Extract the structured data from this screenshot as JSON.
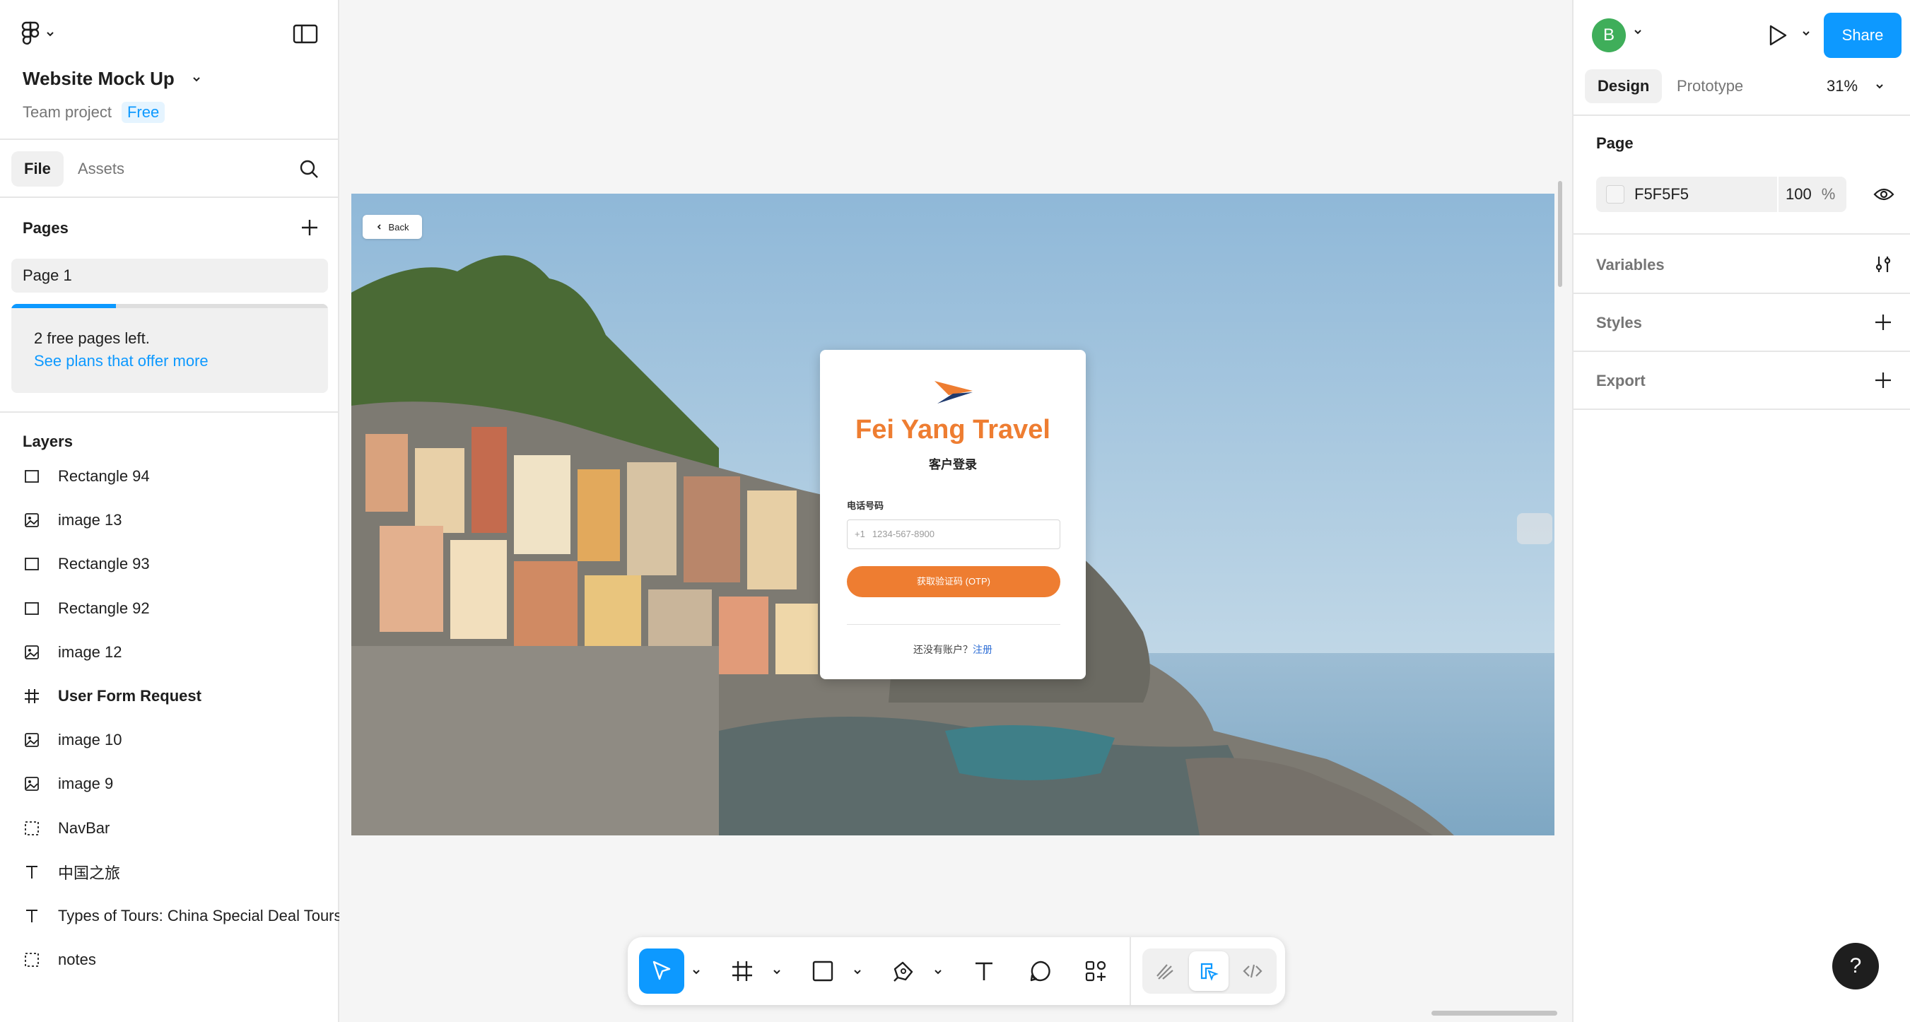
{
  "left_panel": {
    "file_name": "Website Mock Up",
    "project_label": "Team project",
    "plan_badge": "Free",
    "tabs": {
      "file": "File",
      "assets": "Assets"
    },
    "pages_title": "Pages",
    "pages": [
      "Page 1"
    ],
    "quota": {
      "text": "2 free pages left.",
      "link": "See plans that offer more",
      "used_fraction": 0.33
    },
    "layers_title": "Layers",
    "layers": [
      {
        "name": "Rectangle 94",
        "icon": "rectangle-icon"
      },
      {
        "name": "image 13",
        "icon": "image-icon"
      },
      {
        "name": "Rectangle 93",
        "icon": "rectangle-icon"
      },
      {
        "name": "Rectangle 92",
        "icon": "rectangle-icon"
      },
      {
        "name": "image 12",
        "icon": "image-icon"
      },
      {
        "name": "User Form Request",
        "icon": "frame-icon"
      },
      {
        "name": "image 10",
        "icon": "image-icon"
      },
      {
        "name": "image 9",
        "icon": "image-icon"
      },
      {
        "name": "NavBar",
        "icon": "component-frame-icon"
      },
      {
        "name": "中国之旅",
        "icon": "text-icon"
      },
      {
        "name": "Types of Tours: China Special Deal Tours",
        "icon": "text-icon"
      },
      {
        "name": "notes",
        "icon": "component-frame-icon"
      }
    ]
  },
  "canvas": {
    "back_label": "Back",
    "brand_name": "Fei Yang Travel",
    "login_title": "客户登录",
    "phone_label": "电话号码",
    "phone_prefix": "+1",
    "phone_placeholder": "1234-567-8900",
    "otp_button": "获取验证码 (OTP)",
    "signup_prompt": "还没有账户？",
    "signup_link": "注册"
  },
  "right_panel": {
    "avatar_initial": "B",
    "share_label": "Share",
    "tabs": {
      "design": "Design",
      "prototype": "Prototype"
    },
    "zoom": "31%",
    "page_section": "Page",
    "page_color": "F5F5F5",
    "page_opacity": "100",
    "opacity_unit": "%",
    "variables_section": "Variables",
    "styles_section": "Styles",
    "export_section": "Export",
    "help_label": "?"
  },
  "colors": {
    "accent": "#0d99ff",
    "brand_orange": "#ee7d31",
    "avatar": "#3fae5a"
  }
}
